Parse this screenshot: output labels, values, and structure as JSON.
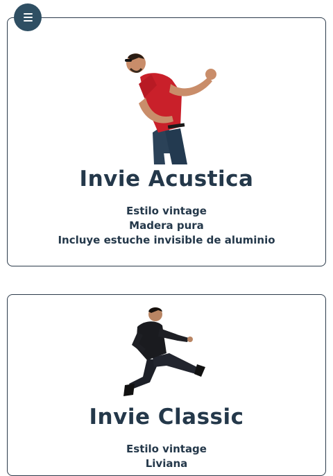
{
  "menu": {
    "icon": "hamburger-menu-icon"
  },
  "products": [
    {
      "name": "Invie Acustica",
      "image": "man-playing-air-guitar-image",
      "features": [
        "Estilo vintage",
        "Madera pura",
        "Incluye estuche invisible de aluminio"
      ]
    },
    {
      "name": "Invie Classic",
      "image": "man-jumping-leather-jacket-image",
      "features": [
        "Estilo vintage",
        "Liviana"
      ]
    }
  ],
  "colors": {
    "accent": "#2f4f63",
    "text": "#24384a",
    "border": "#2b3a4a"
  }
}
